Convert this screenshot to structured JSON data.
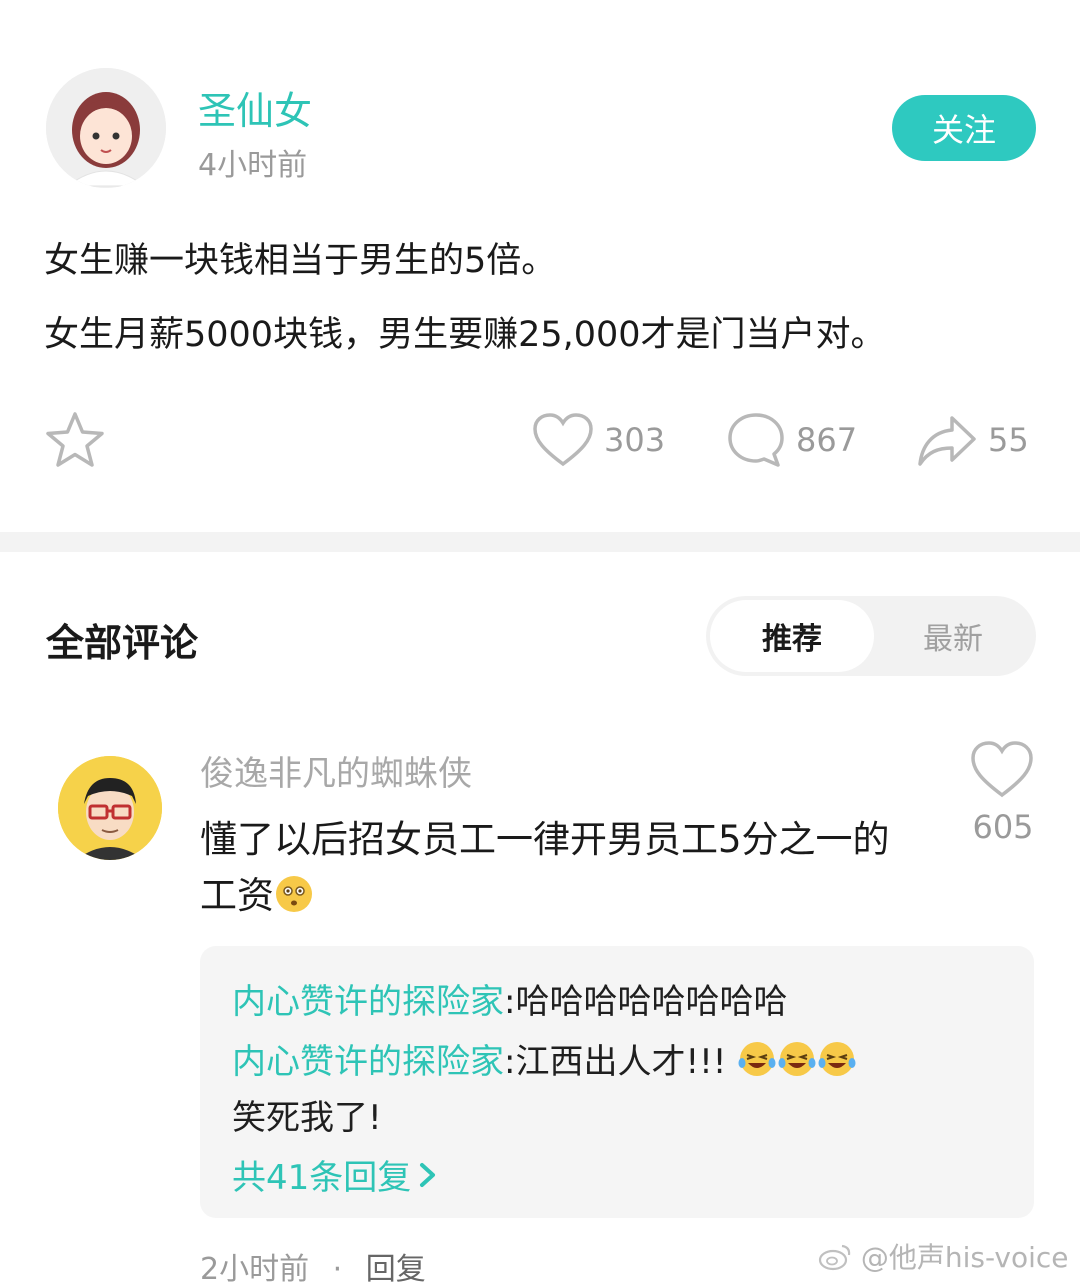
{
  "post": {
    "author": "圣仙女",
    "time": "4小时前",
    "follow_label": "关注",
    "lines": [
      "女生赚一块钱相当于男生的5倍。",
      "女生月薪5000块钱，男生要赚25,000才是门当户对。"
    ],
    "likes": "303",
    "comments": "867",
    "shares": "55"
  },
  "comments_section": {
    "title": "全部评论",
    "tab_recommended": "推荐",
    "tab_latest": "最新"
  },
  "comment": {
    "user": "俊逸非凡的蜘蛛侠",
    "text": "懂了以后招女员工一律开男员工5分之一的工资",
    "likes": "605",
    "replies": [
      {
        "user": "内心赞许的探险家",
        "sep": ":",
        "text": "哈哈哈哈哈哈哈哈"
      },
      {
        "user": "内心赞许的探险家",
        "sep": ":",
        "text": "江西出人才!!!",
        "text2": "笑死我了!"
      }
    ],
    "more_replies": "共41条回复",
    "time": "2小时前",
    "dot": "·",
    "reply_label": "回复"
  },
  "watermark": "@他声his-voice",
  "colors": {
    "accent": "#2ec4b6",
    "follow_bg": "#2ec9c0",
    "muted": "#9a9a9a"
  }
}
